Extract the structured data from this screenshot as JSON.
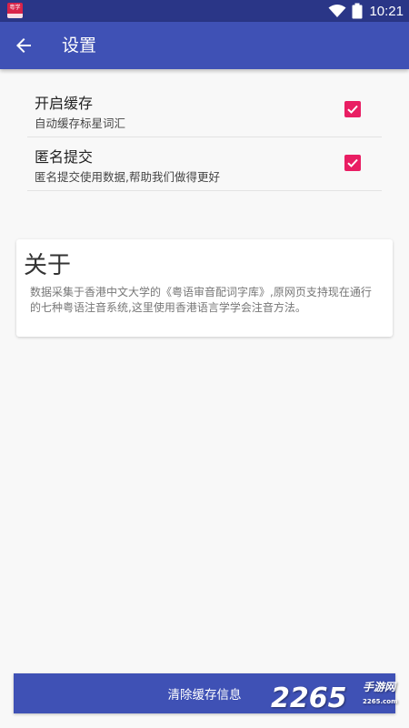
{
  "status_bar": {
    "app_icon_text": "粤学",
    "time": "10:21",
    "icons": [
      "wifi-icon",
      "battery-icon"
    ]
  },
  "toolbar": {
    "back_icon": "arrow-left-icon",
    "title": "设置"
  },
  "settings": [
    {
      "title": "开启缓存",
      "subtitle": "自动缓存标星词汇",
      "checked": true
    },
    {
      "title": "匿名提交",
      "subtitle": "匿名提交使用数据,帮助我们做得更好",
      "checked": true
    }
  ],
  "about": {
    "title": "关于",
    "text": "数据采集于香港中文大学的《粤语审音配词字库》,原网页支持现在通行的七种粤语注音系统,这里使用香港语言学学会注音方法。"
  },
  "clear_button_label": "清除缓存信息",
  "watermark": {
    "number": "2265",
    "text": "手游网",
    "site": "2265.com"
  },
  "colors": {
    "primary": "#3f51b5",
    "primary_dark": "#2a3687",
    "accent": "#e91e63"
  }
}
